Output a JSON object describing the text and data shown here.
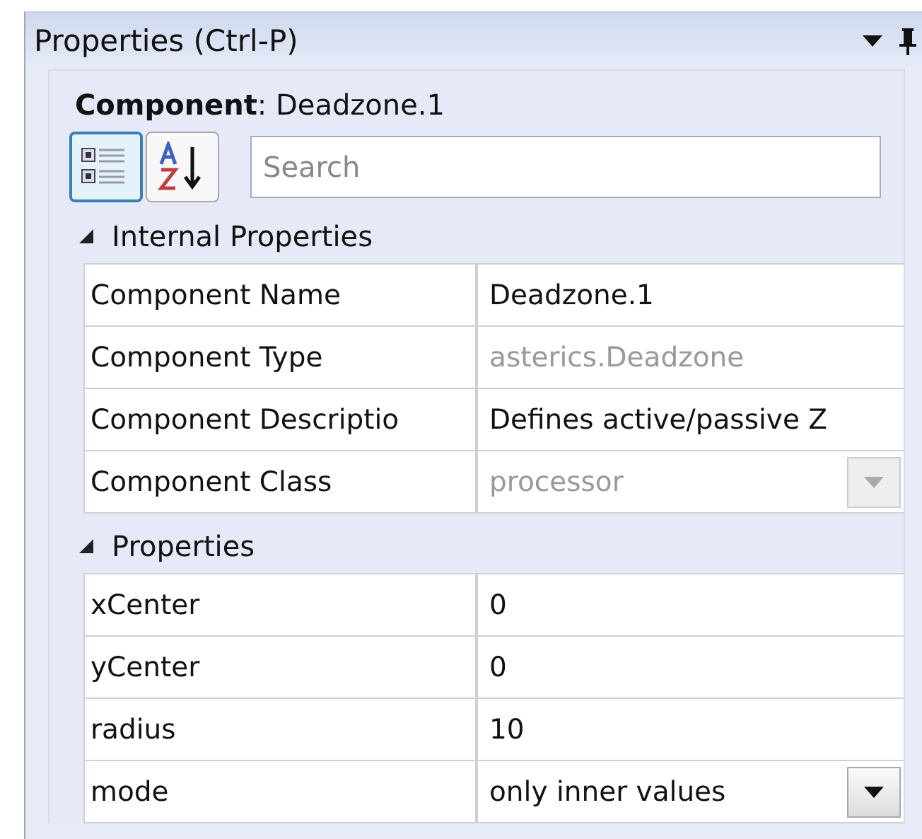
{
  "window": {
    "title": "Properties (Ctrl-P)"
  },
  "header": {
    "text": "**Component**: Deadzone.1"
  },
  "view_buttons": [
    {
      "kind": "categorized",
      "selected": true
    },
    {
      "kind": "alphabetical",
      "selected": false
    }
  ],
  "search": {
    "placeholder": "Search"
  },
  "sections": [
    {
      "title": "Internal Properties",
      "expanded": true,
      "rows": [
        {
          "name": "Component Name",
          "value": "Deadzone.1",
          "kind": "text",
          "readonly": false
        },
        {
          "name": "Component Type",
          "value": "asterics.Deadzone",
          "kind": "text",
          "readonly": true
        },
        {
          "name": "Component Descriptio",
          "value": "Defines active/passive Z",
          "kind": "text",
          "readonly": false
        },
        {
          "name": "Component Class",
          "value": "processor",
          "kind": "dropdown",
          "readonly": true
        }
      ]
    },
    {
      "title": "Properties",
      "expanded": true,
      "rows": [
        {
          "name": "xCenter",
          "value": "0",
          "kind": "text",
          "readonly": false
        },
        {
          "name": "yCenter",
          "value": "0",
          "kind": "text",
          "readonly": false
        },
        {
          "name": "radius",
          "value": "10",
          "kind": "text",
          "readonly": false
        },
        {
          "name": "mode",
          "value": "only inner values",
          "kind": "dropdown",
          "readonly": false
        }
      ]
    }
  ]
}
